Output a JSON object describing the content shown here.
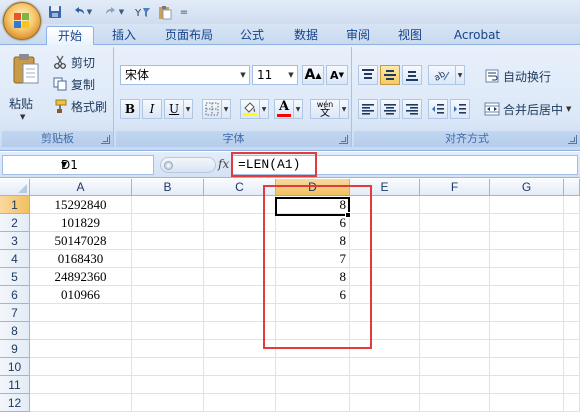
{
  "quick_access": {
    "icons": [
      "save-icon",
      "undo-icon",
      "redo-icon",
      "filter-icon",
      "paste-icon",
      "customize-icon"
    ],
    "customize_glyph": "="
  },
  "tabs": [
    {
      "label": "开始",
      "active": true
    },
    {
      "label": "插入",
      "active": false
    },
    {
      "label": "页面布局",
      "active": false
    },
    {
      "label": "公式",
      "active": false
    },
    {
      "label": "数据",
      "active": false
    },
    {
      "label": "审阅",
      "active": false
    },
    {
      "label": "视图",
      "active": false
    },
    {
      "label": "Acrobat",
      "active": false
    }
  ],
  "ribbon": {
    "clipboard": {
      "paste_label": "粘贴",
      "cut_label": "剪切",
      "copy_label": "复制",
      "format_painter_label": "格式刷",
      "group_label": "剪贴板"
    },
    "font": {
      "font_name": "宋体",
      "font_size": "11",
      "grow_label": "A",
      "shrink_label": "A",
      "bold_label": "B",
      "italic_label": "I",
      "underline_label": "U",
      "font_color_label": "A",
      "phonetic_label": "wén",
      "phonetic_sub": "文",
      "group_label": "字体",
      "fill_color": "#ffff00",
      "font_color": "#ff0000"
    },
    "alignment": {
      "wrap_text_label": "自动换行",
      "merge_center_label": "合并后居中",
      "group_label": "对齐方式"
    }
  },
  "formula_bar": {
    "name_box": "D1",
    "fx_label": "fx",
    "formula": "=LEN(A1)"
  },
  "grid": {
    "columns": [
      "A",
      "B",
      "C",
      "D",
      "E",
      "F",
      "G"
    ],
    "selected_column": "D",
    "rows": [
      "1",
      "2",
      "3",
      "4",
      "5",
      "6",
      "7",
      "8",
      "9",
      "10",
      "11",
      "12"
    ],
    "selected_row": "1",
    "col_a_values": [
      "15292840",
      "101829",
      "50147028",
      "0168430",
      "24892360",
      "010966"
    ],
    "col_d_values": [
      "8",
      "6",
      "8",
      "7",
      "8",
      "6"
    ]
  },
  "colors": {
    "annotation_red": "#e23b3b",
    "ribbon_text": "#15428b"
  }
}
